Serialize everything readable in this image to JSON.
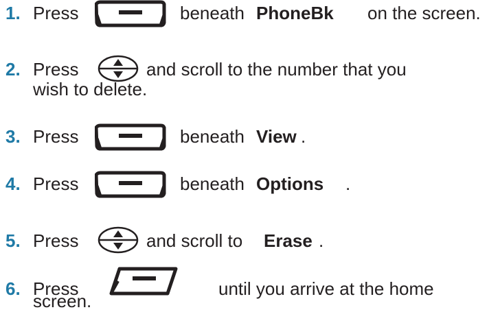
{
  "steps": [
    {
      "number": "1.",
      "press": "Press",
      "after_icon": "beneath",
      "bold": "PhoneBk",
      "tail": "on the screen.",
      "icon": "soft-key-button-icon"
    },
    {
      "number": "2.",
      "press": "Press",
      "after_icon": "and scroll to the number that you",
      "line2": "wish to delete.",
      "icon": "scroll-navigation-key-icon"
    },
    {
      "number": "3.",
      "press": "Press",
      "after_icon": "beneath",
      "bold": "View",
      "tail": ".",
      "icon": "soft-key-button-icon"
    },
    {
      "number": "4.",
      "press": "Press",
      "after_icon": "beneath",
      "bold": "Options",
      "tail": ".",
      "icon": "soft-key-button-icon"
    },
    {
      "number": "5.",
      "press": "Press",
      "after_icon": "and scroll to",
      "bold": "Erase",
      "tail": ".",
      "icon": "scroll-navigation-key-icon"
    },
    {
      "number": "6.",
      "press": "Press",
      "after_icon": "until you arrive at the home",
      "line2": "screen.",
      "icon": "end-key-button-icon"
    }
  ],
  "colors": {
    "step_number": "#1f7aa6",
    "text": "#231f20",
    "icon": "#231f20"
  }
}
